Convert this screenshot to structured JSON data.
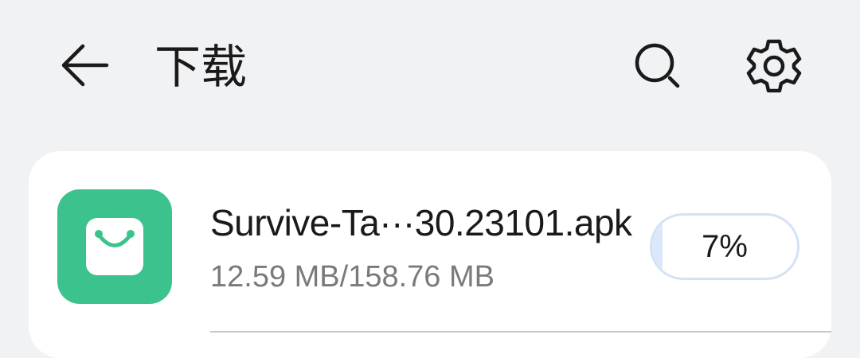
{
  "header": {
    "title": "下载",
    "back_icon": "back-arrow-icon",
    "search_icon": "search-icon",
    "settings_icon": "gear-icon"
  },
  "download": {
    "file_name": "Survive-Ta···30.23101.apk",
    "size_text": "12.59 MB/158.76 MB",
    "progress_text": "7%",
    "progress": 0.07,
    "app_icon": "shopping-bag-icon",
    "icon_color": "#3cc38d"
  },
  "colors": {
    "background": "#f1f2f4",
    "card": "#ffffff",
    "progress_border": "#d4e2f6",
    "progress_fill": "#dbe8fb"
  }
}
